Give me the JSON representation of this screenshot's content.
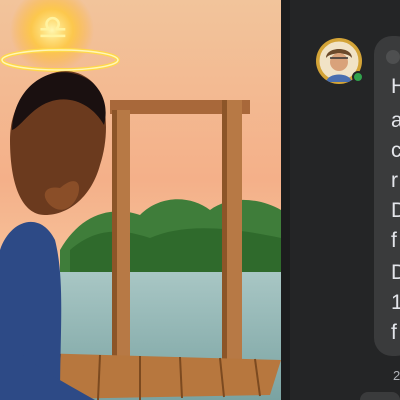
{
  "post_image": {
    "icon": "libra-zodiac-symbol"
  },
  "comment": {
    "author_avatar": "profile-photo",
    "online_status_color": "#31a24c",
    "lines": [
      "H",
      "a",
      "c",
      "r",
      "D",
      "f",
      "D",
      "1",
      "f"
    ],
    "timestamp": "2"
  },
  "colors": {
    "panel_bg": "#242526",
    "bubble_bg": "#3a3b3c",
    "text": "#e4e6eb",
    "muted": "#b0b3b8",
    "halo": "#f5c518"
  }
}
